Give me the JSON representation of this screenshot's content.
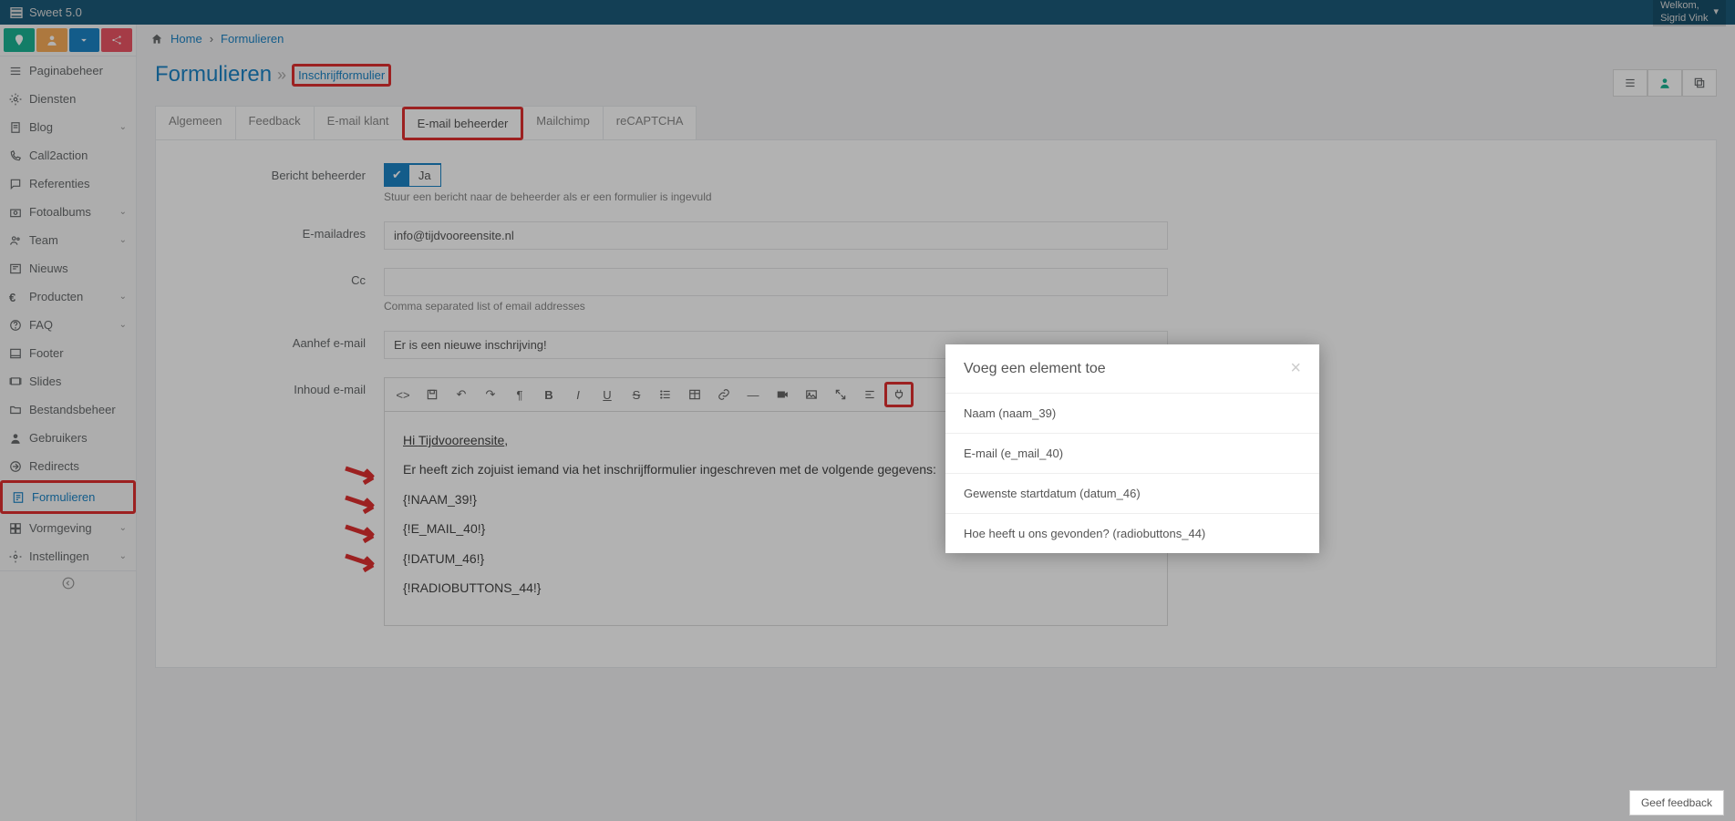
{
  "brand": "Sweet 5.0",
  "welcome": {
    "label": "Welkom,",
    "user": "Sigrid Vink"
  },
  "breadcrumb": {
    "home": "Home",
    "section": "Formulieren"
  },
  "page": {
    "title": "Formulieren",
    "subtitle": "Inschrijfformulier"
  },
  "sidebar": {
    "items": [
      {
        "label": "Paginabeheer"
      },
      {
        "label": "Diensten"
      },
      {
        "label": "Blog"
      },
      {
        "label": "Call2action"
      },
      {
        "label": "Referenties"
      },
      {
        "label": "Fotoalbums"
      },
      {
        "label": "Team"
      },
      {
        "label": "Nieuws"
      },
      {
        "label": "Producten"
      },
      {
        "label": "FAQ"
      },
      {
        "label": "Footer"
      },
      {
        "label": "Slides"
      },
      {
        "label": "Bestandsbeheer"
      },
      {
        "label": "Gebruikers"
      },
      {
        "label": "Redirects"
      },
      {
        "label": "Formulieren"
      },
      {
        "label": "Vormgeving"
      },
      {
        "label": "Instellingen"
      }
    ]
  },
  "tabs": [
    {
      "label": "Algemeen"
    },
    {
      "label": "Feedback"
    },
    {
      "label": "E-mail klant"
    },
    {
      "label": "E-mail beheerder"
    },
    {
      "label": "Mailchimp"
    },
    {
      "label": "reCAPTCHA"
    }
  ],
  "form": {
    "bericht_label": "Bericht beheerder",
    "bericht_toggle": "Ja",
    "bericht_help": "Stuur een bericht naar de beheerder als er een formulier is ingevuld",
    "email_label": "E-mailadres",
    "email_value": "info@tijdvooreensite.nl",
    "cc_label": "Cc",
    "cc_value": "",
    "cc_help": "Comma separated list of email addresses",
    "aanhef_label": "Aanhef e-mail",
    "aanhef_value": "Er is een nieuwe inschrijving!",
    "inhoud_label": "Inhoud e-mail"
  },
  "editor": {
    "greeting_prefix": "Hi ",
    "greeting_name": "Tijdvooreensite",
    "greeting_suffix": ",",
    "intro": "Er heeft zich zojuist iemand via het inschrijfformulier ingeschreven met de volgende gegevens:",
    "ph1": "{!NAAM_39!}",
    "ph2": "{!E_MAIL_40!}",
    "ph3": "{!DATUM_46!}",
    "ph4": "{!RADIOBUTTONS_44!}"
  },
  "modal": {
    "title": "Voeg een element toe",
    "items": [
      "Naam (naam_39)",
      "E-mail (e_mail_40)",
      "Gewenste startdatum (datum_46)",
      "Hoe heeft u ons gevonden? (radiobuttons_44)"
    ]
  },
  "feedback": "Geef feedback"
}
